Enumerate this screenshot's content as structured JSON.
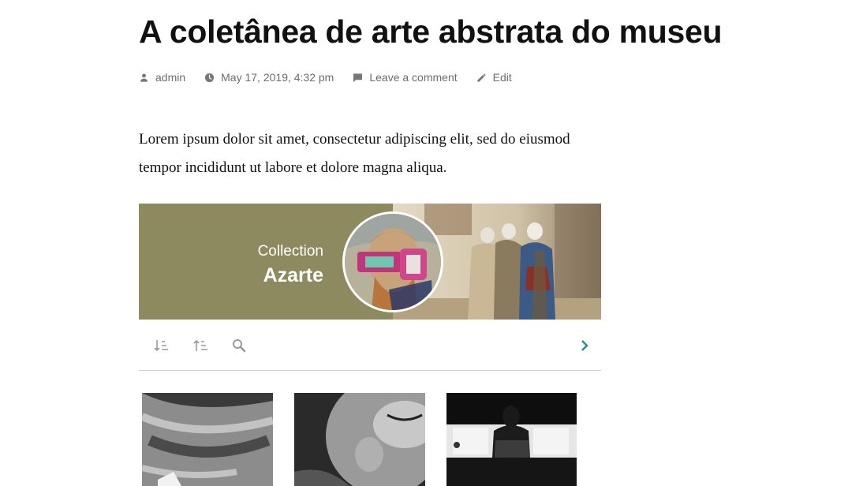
{
  "post": {
    "title": "A coletânea de arte abstrata do museu",
    "meta": {
      "author": "admin",
      "date": "May 17, 2019, 4:32 pm",
      "comment": "Leave a comment",
      "edit": "Edit"
    },
    "body": "Lorem ipsum dolor sit amet, consectetur adipiscing elit, sed do eiusmod tempor incididunt ut labore et dolore magna aliqua."
  },
  "collection": {
    "label": "Collection",
    "name": "Azarte",
    "banner_color": "#8c8a5e"
  },
  "toolbar": {
    "icons": [
      "sort-descending-icon",
      "sort-ascending-icon",
      "search-icon",
      "chevron-right-icon"
    ],
    "accent": "#2a8a96"
  },
  "thumbnails": [
    "hair-closeup-photo",
    "face-closeup-photo",
    "woman-silhouette-photo"
  ]
}
